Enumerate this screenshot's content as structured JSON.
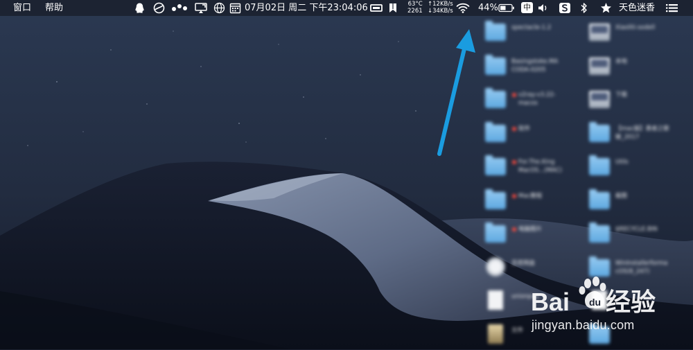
{
  "menubar": {
    "menu_window": "窗口",
    "menu_help": "帮助",
    "clock": "07月02日  周二  下午23:04:06",
    "stats_cpu_temp": "63°C",
    "stats_fan": "2261",
    "net_up": "↑12KB/s",
    "net_down": "↓34KB/s",
    "battery_percent": "44%",
    "input_method": "中",
    "username": "天色迷香",
    "icons": [
      "qq-icon",
      "vpn-icon",
      "dots-icon",
      "screen-cast-icon",
      "globe-icon",
      "calendar-icon",
      "display-icon",
      "bookmark-icon",
      "wifi-icon",
      "battery-icon",
      "volume-icon",
      "sogou-icon",
      "bluetooth-icon",
      "star-icon",
      "list-icon"
    ]
  },
  "desktop": {
    "items": [
      {
        "label": "spectacle-1.2",
        "kind": "folder",
        "tag": false
      },
      {
        "label": "Basingstoke.MA\nCODA-0205",
        "kind": "folder",
        "tag": false
      },
      {
        "label": "v2ray-v3.22-\nmacos",
        "kind": "folder",
        "tag": true
      },
      {
        "label": "软件",
        "kind": "folder-doc",
        "tag": true
      },
      {
        "label": "For.The.King\nMacOS...(MAC)",
        "kind": "folder",
        "tag": true
      },
      {
        "label": "Mac教程",
        "kind": "folder",
        "tag": true
      },
      {
        "label": "电脑图片",
        "kind": "folder",
        "tag": true
      },
      {
        "label": "百度网盘",
        "kind": "app",
        "tag": false
      },
      {
        "label": "unionpay",
        "kind": "doc",
        "tag": false
      },
      {
        "label": "文件",
        "kind": "photo",
        "tag": false
      },
      {
        "label": "Xiaoliti-sodell",
        "kind": "disk",
        "tag": false
      },
      {
        "label": "本地",
        "kind": "disk",
        "tag": false
      },
      {
        "label": "下载",
        "kind": "disk",
        "tag": false
      },
      {
        "label": "【mac版】勇者之歌\n破_2017",
        "kind": "folder",
        "tag": false
      },
      {
        "label": "Utils",
        "kind": "folder",
        "tag": false
      },
      {
        "label": "截图",
        "kind": "folder",
        "tag": false
      },
      {
        "label": "$RECYCLE.BIN",
        "kind": "folder",
        "tag": false
      },
      {
        "label": "WinInstallerforma\ncOS(8_247)",
        "kind": "folder",
        "tag": false
      },
      {
        "label": "",
        "kind": "doc",
        "tag": false
      },
      {
        "label": "",
        "kind": "folder",
        "tag": false
      }
    ]
  },
  "watermark": {
    "brand": "Bai du 经验",
    "url": "jingyan.baidu.com"
  },
  "colors": {
    "sky_top": "#2b3952",
    "sky_bottom": "#0e1422",
    "dune_light": "#6a7893",
    "folder_blue": "#6fb4e8",
    "arrow_blue": "#1a9ce0"
  }
}
